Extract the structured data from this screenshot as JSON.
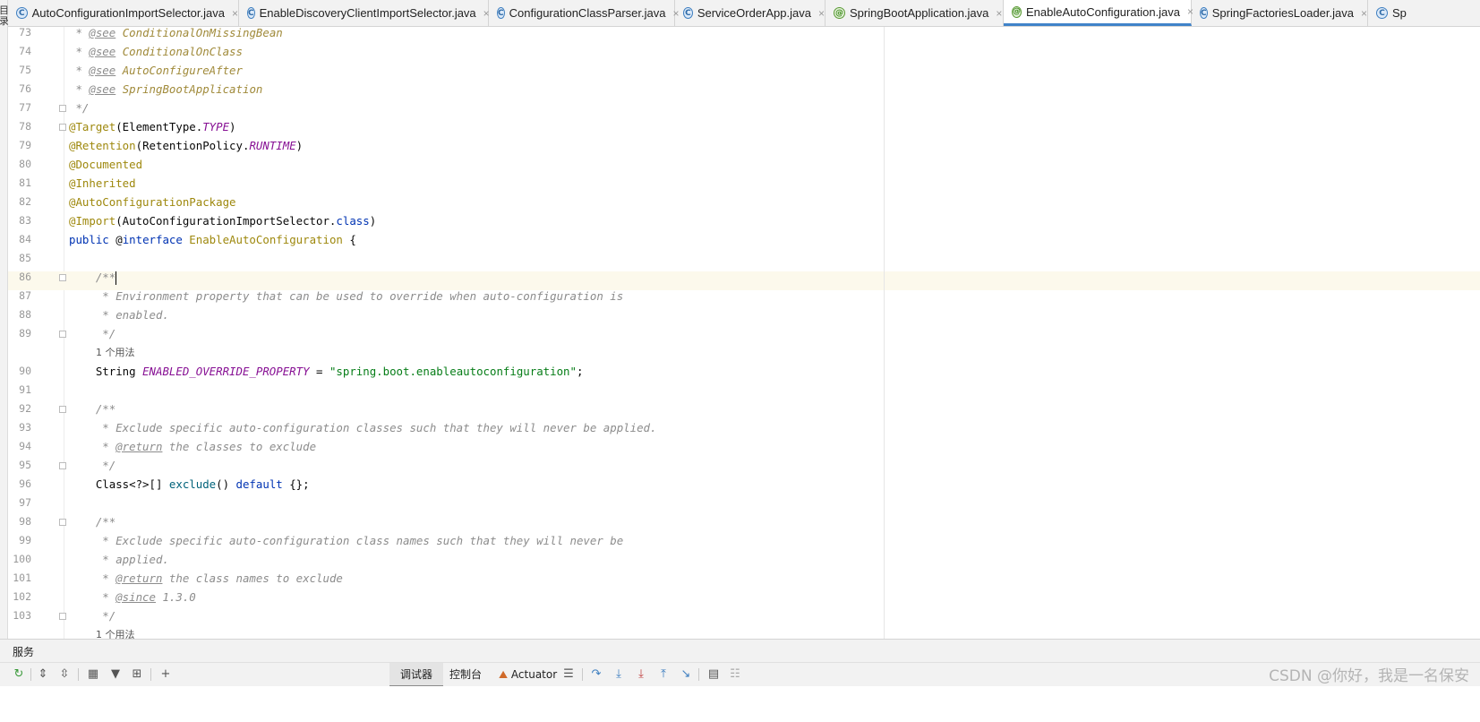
{
  "left_strip": {
    "glyph_a": "目",
    "glyph_b": "录"
  },
  "tabs": [
    {
      "label": "AutoConfigurationImportSelector.java",
      "icon": "class-icon",
      "active": false
    },
    {
      "label": "EnableDiscoveryClientImportSelector.java",
      "icon": "class-icon",
      "active": false
    },
    {
      "label": "ConfigurationClassParser.java",
      "icon": "class-icon",
      "active": false
    },
    {
      "label": "ServiceOrderApp.java",
      "icon": "run-class-icon",
      "active": false
    },
    {
      "label": "SpringBootApplication.java",
      "icon": "annotation-icon",
      "active": false
    },
    {
      "label": "EnableAutoConfiguration.java",
      "icon": "annotation-icon",
      "active": true
    },
    {
      "label": "SpringFactoriesLoader.java",
      "icon": "run-class-icon",
      "active": false
    },
    {
      "label": "Sp",
      "icon": "run-class-icon",
      "active": false
    }
  ],
  "editor": {
    "current_line": "86",
    "lines": [
      {
        "n": "73",
        "text": " * @see ConditionalOnMissingBean"
      },
      {
        "n": "74",
        "text": " * @see ConditionalOnClass"
      },
      {
        "n": "75",
        "text": " * @see AutoConfigureAfter"
      },
      {
        "n": "76",
        "text": " * @see SpringBootApplication"
      },
      {
        "n": "77",
        "text": " */"
      },
      {
        "n": "78",
        "text": "@Target(ElementType.TYPE)"
      },
      {
        "n": "79",
        "text": "@Retention(RetentionPolicy.RUNTIME)"
      },
      {
        "n": "80",
        "text": "@Documented"
      },
      {
        "n": "81",
        "text": "@Inherited"
      },
      {
        "n": "82",
        "text": "@AutoConfigurationPackage"
      },
      {
        "n": "83",
        "text": "@Import(AutoConfigurationImportSelector.class)"
      },
      {
        "n": "84",
        "text": "public @interface EnableAutoConfiguration {"
      },
      {
        "n": "85",
        "text": ""
      },
      {
        "n": "86",
        "text": "    /**"
      },
      {
        "n": "87",
        "text": "     * Environment property that can be used to override when auto-configuration is"
      },
      {
        "n": "88",
        "text": "     * enabled."
      },
      {
        "n": "89",
        "text": "     */"
      },
      {
        "hint": "1 个用法"
      },
      {
        "n": "90",
        "text": "    String ENABLED_OVERRIDE_PROPERTY = \"spring.boot.enableautoconfiguration\";"
      },
      {
        "n": "91",
        "text": ""
      },
      {
        "n": "92",
        "text": "    /**"
      },
      {
        "n": "93",
        "text": "     * Exclude specific auto-configuration classes such that they will never be applied."
      },
      {
        "n": "94",
        "text": "     * @return the classes to exclude"
      },
      {
        "n": "95",
        "text": "     */"
      },
      {
        "n": "96",
        "text": "    Class<?>[] exclude() default {};"
      },
      {
        "n": "97",
        "text": ""
      },
      {
        "n": "98",
        "text": "    /**"
      },
      {
        "n": "99",
        "text": "     * Exclude specific auto-configuration class names such that they will never be"
      },
      {
        "n": "100",
        "text": "     * applied."
      },
      {
        "n": "101",
        "text": "     * @return the class names to exclude"
      },
      {
        "n": "102",
        "text": "     * @since 1.3.0"
      },
      {
        "n": "103",
        "text": "     */"
      },
      {
        "hint": "1 个用法"
      }
    ]
  },
  "services_panel": {
    "title": "服务"
  },
  "bottom_tabs": [
    {
      "label": "调试器",
      "active": true
    },
    {
      "label": "控制台",
      "active": false
    },
    {
      "label": "Actuator",
      "active": false
    }
  ],
  "watermark": "CSDN @你好，我是一名保安",
  "colors": {
    "accent": "#4083c9",
    "current_line_bg": "#fcf9ec",
    "keyword": "#0033b3",
    "annotation": "#9e880d",
    "string": "#067d17",
    "constant": "#871094",
    "comment": "#8c8c8c"
  }
}
